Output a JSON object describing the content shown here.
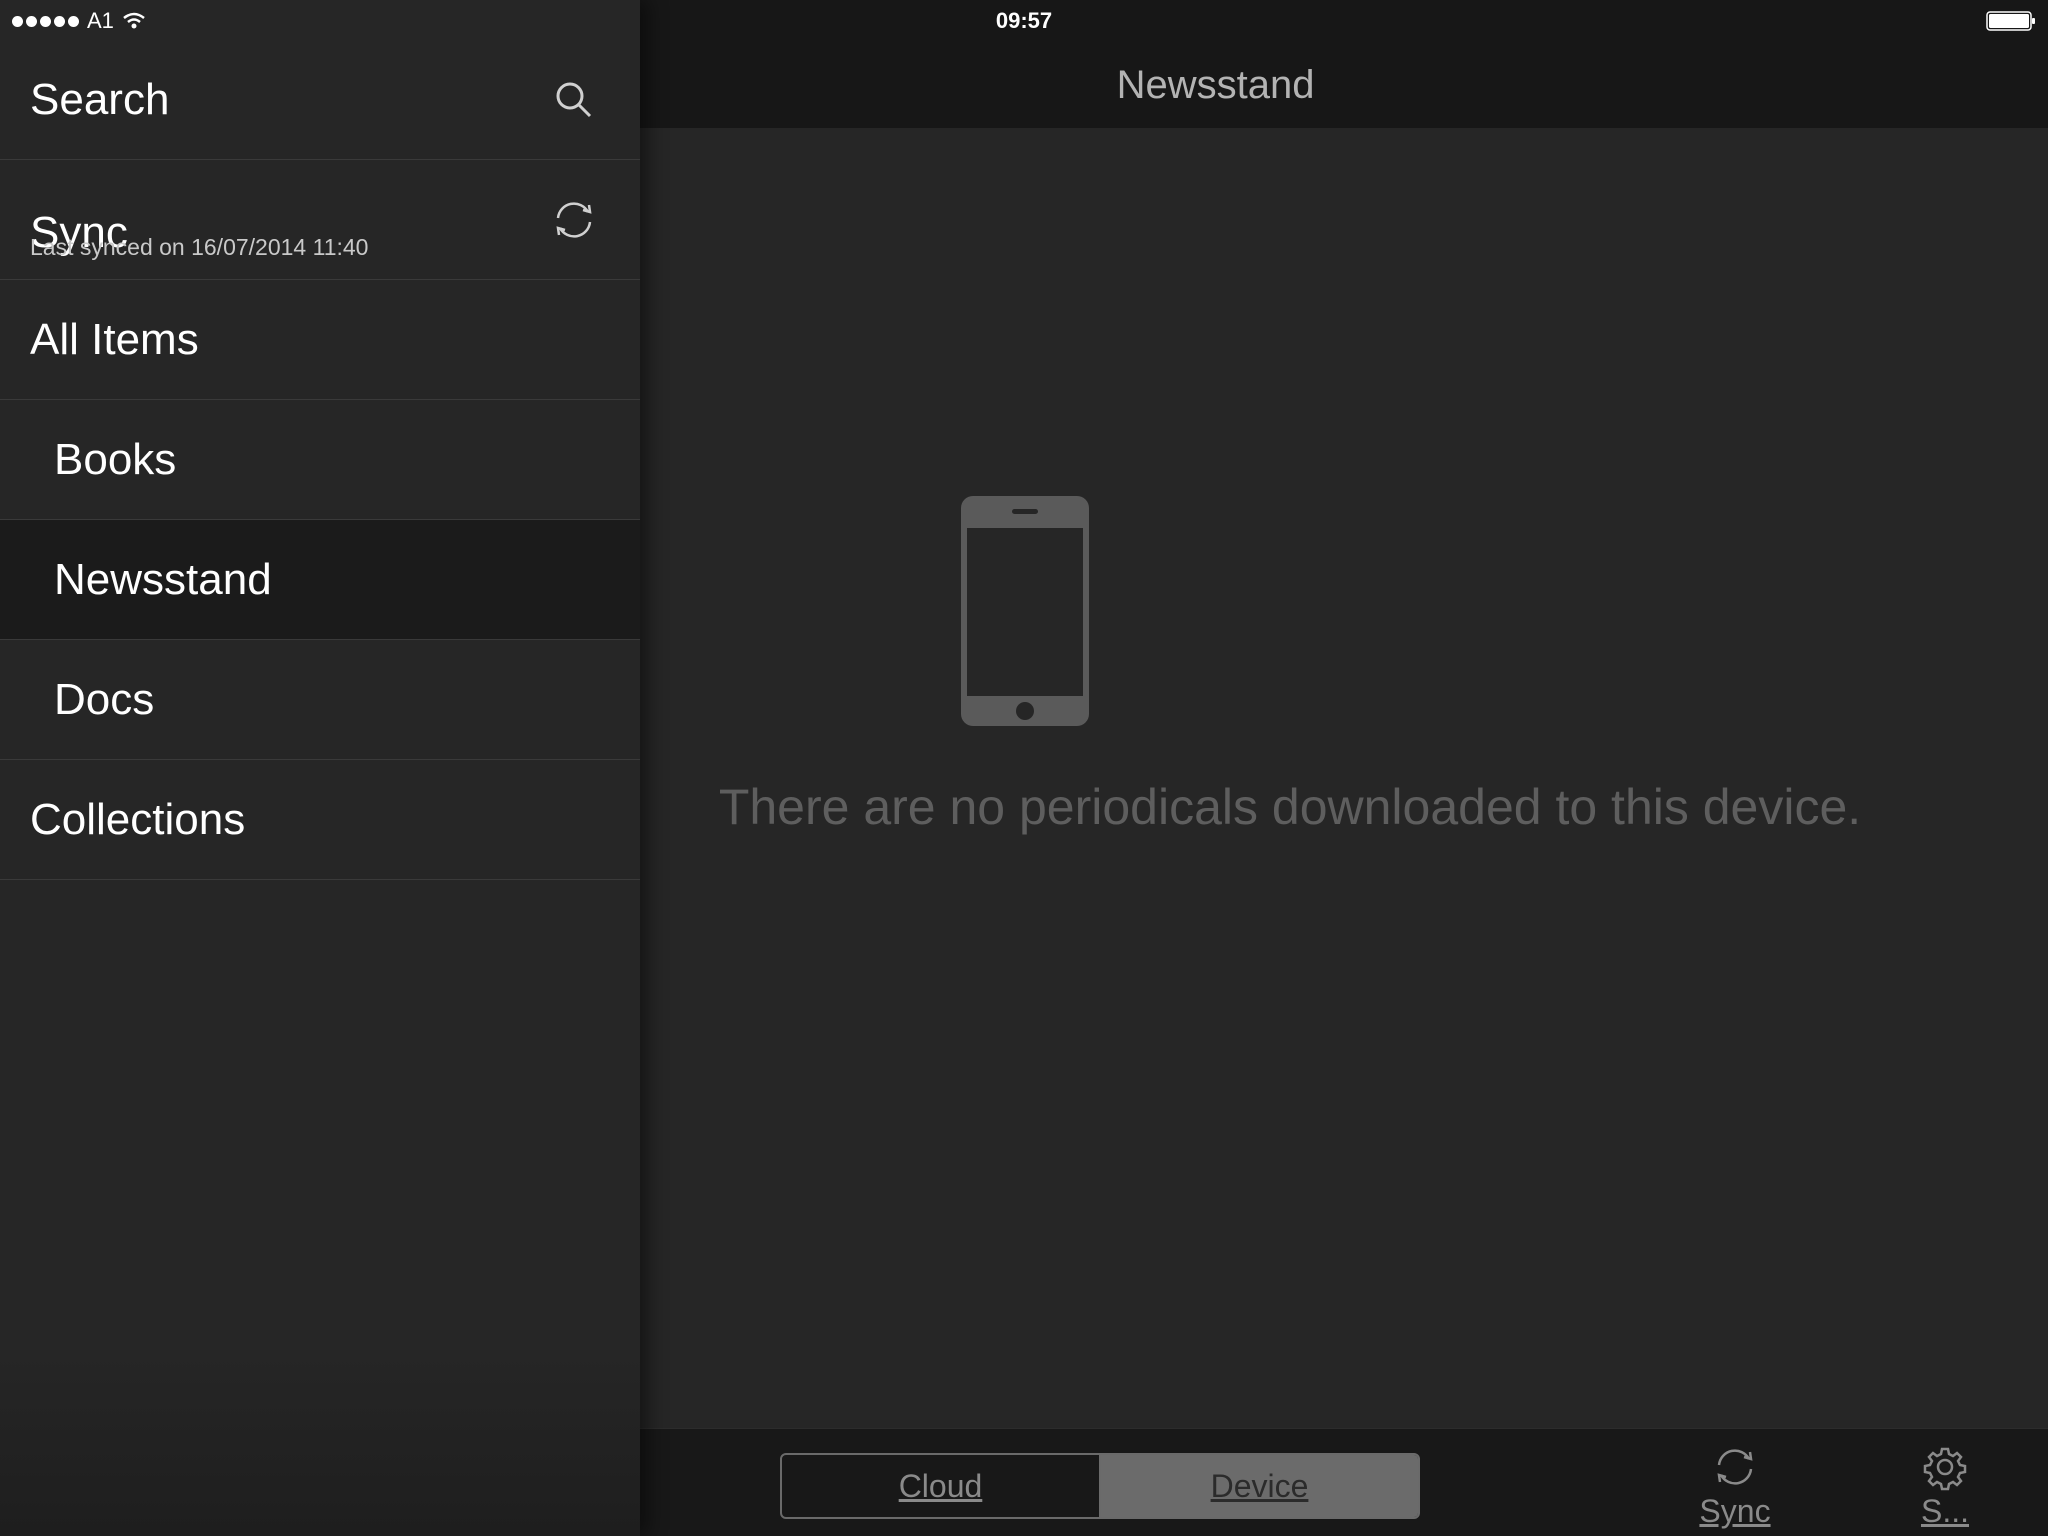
{
  "status_bar": {
    "carrier": "A1",
    "time": "09:57"
  },
  "sidebar": {
    "search_label": "Search",
    "sync_label": "Sync",
    "sync_status": "Last synced on 16/07/2014 11:40",
    "items": [
      {
        "label": "All Items"
      },
      {
        "label": "Books"
      },
      {
        "label": "Newsstand",
        "selected": true
      },
      {
        "label": "Docs"
      },
      {
        "label": "Collections"
      }
    ]
  },
  "navbar": {
    "title": "Newsstand"
  },
  "main": {
    "empty_message": "There are no periodicals downloaded to this device."
  },
  "bottom_bar": {
    "segments": [
      {
        "label": "Cloud",
        "selected": false
      },
      {
        "label": "Device",
        "selected": true
      }
    ],
    "sync_label": "Sync",
    "settings_label": "S..."
  },
  "icons": {
    "search": "search-icon",
    "sync": "sync-icon",
    "settings": "gear-icon",
    "device": "phone-icon",
    "wifi": "wifi-icon",
    "battery": "battery-icon"
  }
}
